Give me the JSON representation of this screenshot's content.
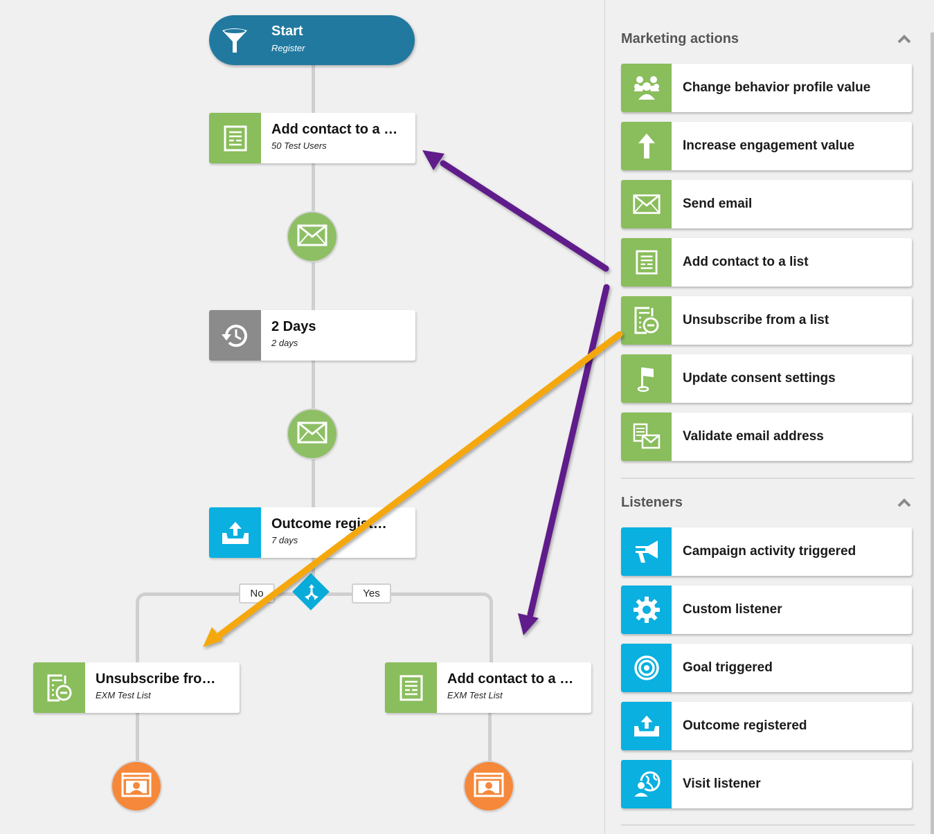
{
  "canvas": {
    "start": {
      "title": "Start",
      "subtitle": "Register",
      "icon": "funnel-icon",
      "color": "#21799f"
    },
    "nodes": [
      {
        "id": "add-contact-top",
        "title": "Add contact to a …",
        "subtitle": "50 Test Users",
        "icon": "list-icon",
        "color": "#8abd5c"
      },
      {
        "id": "wait-2-days",
        "title": "2 Days",
        "subtitle": "2 days",
        "icon": "clock-history-icon",
        "color": "#8b8b8b"
      },
      {
        "id": "outcome-registered",
        "title": "Outcome regist…",
        "subtitle": "7 days",
        "icon": "outcome-upload-icon",
        "color": "#09b0e0"
      },
      {
        "id": "unsubscribe-branch",
        "title": "Unsubscribe fro…",
        "subtitle": "EXM Test List",
        "icon": "unsubscribe-list-icon",
        "color": "#8abd5c"
      },
      {
        "id": "add-contact-branch",
        "title": "Add contact to a …",
        "subtitle": "EXM Test List",
        "icon": "list-icon",
        "color": "#8abd5c"
      }
    ],
    "email_steps": [
      {
        "icon": "envelope-icon"
      },
      {
        "icon": "envelope-icon"
      }
    ],
    "decision": {
      "icon": "split-icon",
      "no_label": "No",
      "yes_label": "Yes",
      "color": "#09acd9"
    },
    "end_steps": [
      {
        "icon": "exit-profile-icon",
        "color": "#f6883b"
      },
      {
        "icon": "exit-profile-icon",
        "color": "#f6883b"
      }
    ],
    "annotations": [
      {
        "color": "#5e1f8a",
        "from": "Add contact to a list",
        "to": "add-contact-top"
      },
      {
        "color": "#5e1f8a",
        "from": "Add contact to a list",
        "to": "add-contact-branch"
      },
      {
        "color": "#f5a80a",
        "from": "Unsubscribe from a list",
        "to": "unsubscribe-branch"
      }
    ]
  },
  "panel": {
    "marketing": {
      "title": "Marketing actions",
      "color": "#8abd5c",
      "items": [
        {
          "label": "Change behavior profile value",
          "icon": "people-group-icon"
        },
        {
          "label": "Increase engagement value",
          "icon": "arrow-up-icon"
        },
        {
          "label": "Send email",
          "icon": "envelope-icon"
        },
        {
          "label": "Add contact to a list",
          "icon": "list-icon"
        },
        {
          "label": "Unsubscribe from a list",
          "icon": "unsubscribe-list-icon"
        },
        {
          "label": "Update consent settings",
          "icon": "flag-icon"
        },
        {
          "label": "Validate email address",
          "icon": "validate-email-icon"
        }
      ]
    },
    "listeners": {
      "title": "Listeners",
      "color": "#09b0e0",
      "items": [
        {
          "label": "Campaign activity triggered",
          "icon": "megaphone-icon"
        },
        {
          "label": "Custom listener",
          "icon": "gear-icon"
        },
        {
          "label": "Goal triggered",
          "icon": "target-icon"
        },
        {
          "label": "Outcome registered",
          "icon": "outcome-upload-icon"
        },
        {
          "label": "Visit listener",
          "icon": "globe-person-icon"
        }
      ]
    }
  }
}
